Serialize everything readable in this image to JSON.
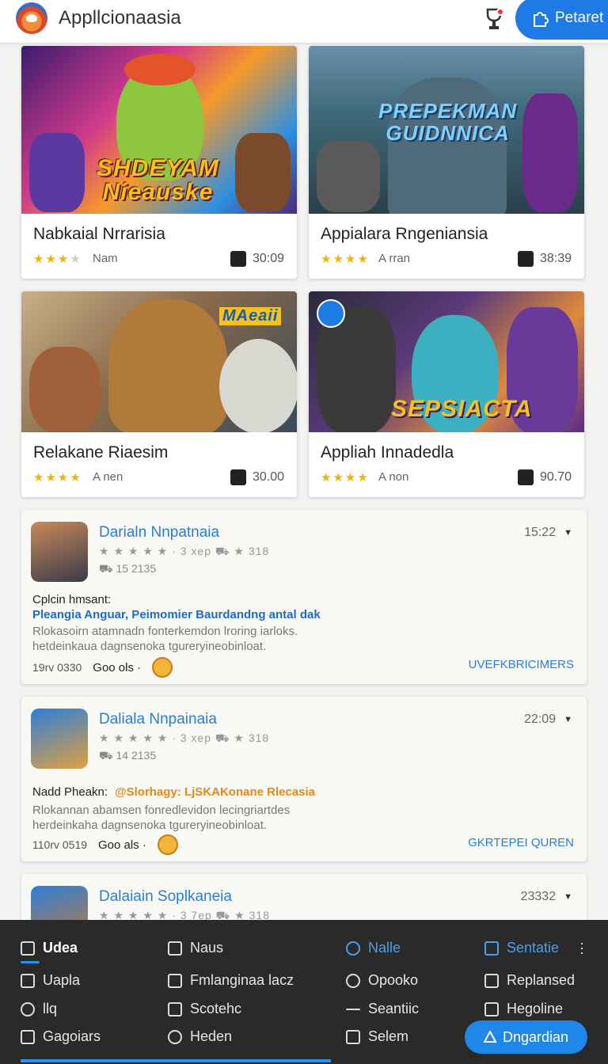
{
  "header": {
    "title": "Appllcionaasia",
    "logo_icon": "app-logo-icon",
    "trophy_icon": "trophy-icon",
    "action_label": "Petaret",
    "action_icon": "puzzle-icon",
    "accent": "#1e7be6"
  },
  "cards": [
    {
      "banner": "SHDEYAM\nNieauske",
      "title": "Nabkaial Nrrarisia",
      "rating": 3,
      "meta": "Nam",
      "count": "30:09",
      "count_icon": "bookmark-icon"
    },
    {
      "banner": "PREPEKMAN\nGUIDNNICA",
      "title": "Appialara Rngeniansia",
      "rating": 4,
      "meta": "A rran",
      "count": "38:39",
      "count_icon": "copy-icon"
    },
    {
      "banner": "MAeaii",
      "title": "Relakane Riaesim",
      "rating": 4,
      "meta": "A nen",
      "count": "30.00",
      "count_icon": "copy-icon"
    },
    {
      "banner": "SEPSIACTA",
      "badge_icon": "fan-icon",
      "title": "Appliah Innadedla",
      "rating": 4,
      "meta": "A non",
      "count": "90.70",
      "count_icon": "copy-icon"
    }
  ],
  "feed": [
    {
      "title": "Darialn Nnpatnaia",
      "time": "15:22",
      "rating_text": "★ ★ ★ ★ ★ · 3 xep   ⛟ ★ 318",
      "sub": "⛟ 15 2135",
      "label": "Cplcin hmsant:",
      "headline": "Pleangia Anguar, Peimomier Baurdandng antal dak",
      "headline_color": "#1f6cc4",
      "desc": "Rlokasoirn atamnadn fonterkemdon lroring iarloks. hetdeinkaua dagnsenoka tgureryineobinloat.",
      "foot_id": "19rv 0330",
      "foot_label": "Goo ols ·",
      "action": "UVEFKBRICIMERS"
    },
    {
      "title": "Daliala Nnpainaia",
      "time": "22:09",
      "rating_text": "★ ★ ★ ★ ★ · 3 xep   ⛟ ★ 318",
      "sub": "⛟ 14 2135",
      "label": "Nadd Pheakn:",
      "headline": "@Slorhagy: LjSKAKonane Rlecasia",
      "headline_color": "#e08a1e",
      "desc": "Rlokannan abamsen fonredlevidon lecingriartdes herdeinkaha dagnsenoka tgureryineobinloat.",
      "foot_id": "110rv 0519",
      "foot_label": "Goo als ·",
      "action": "GKRTEPEI QUREN"
    },
    {
      "title": "Dalaiain Soplkaneia",
      "time": "23332",
      "rating_text": "★ ★ ★ ★ ★ · 3 7ep   ⛟ ★ 318"
    }
  ],
  "menu": {
    "col1": [
      "Udea",
      "Uapla",
      "llq",
      "Gagoiars"
    ],
    "col2": [
      "Naus",
      "Fmlanginaa lacz",
      "Scotehc",
      "Heden"
    ],
    "col3": [
      "Nalle",
      "Opooko",
      "Seantiic",
      "Selem"
    ],
    "col4": [
      "Sentatie",
      "Replansed",
      "Hegoline"
    ],
    "primary": "Dngardian",
    "accent": "#1f86ea"
  }
}
